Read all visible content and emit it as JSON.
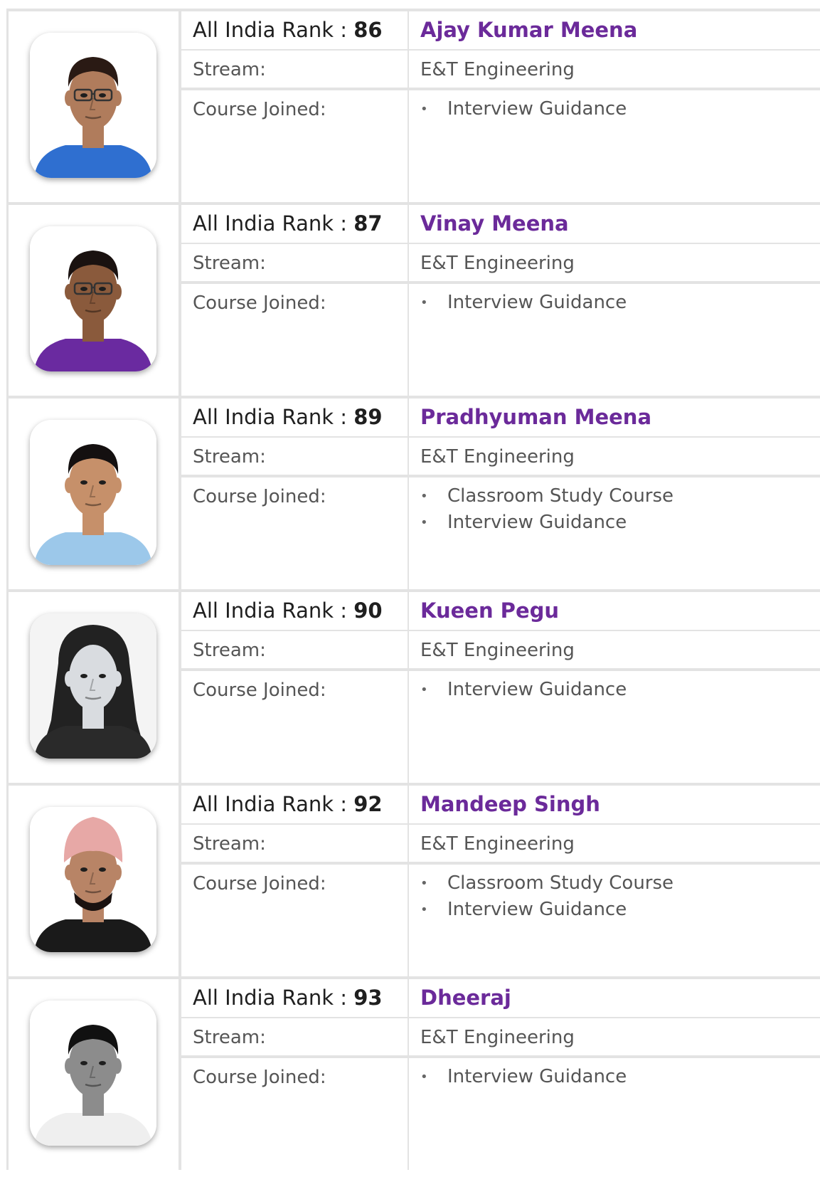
{
  "labels": {
    "rank": "All India Rank",
    "stream": "Stream:",
    "course": "Course Joined:",
    "bullet": "•"
  },
  "students": [
    {
      "rank": "86",
      "name": "Ajay Kumar Meena",
      "stream": "E&T Engineering",
      "courses": [
        "Interview Guidance"
      ],
      "shirt": "#2f6fd0",
      "bg": "#ffffff",
      "skin": "#b07c5c",
      "hair": "#2a1a14",
      "glasses": true,
      "headwear": "none"
    },
    {
      "rank": "87",
      "name": "Vinay Meena",
      "stream": "E&T Engineering",
      "courses": [
        "Interview Guidance"
      ],
      "shirt": "#6a2aa0",
      "bg": "#ffffff",
      "skin": "#8a5a3c",
      "hair": "#1a1210",
      "glasses": true,
      "headwear": "none"
    },
    {
      "rank": "89",
      "name": "Pradhyuman Meena",
      "stream": "E&T Engineering",
      "courses": [
        "Classroom Study Course",
        "Interview Guidance"
      ],
      "shirt": "#9cc8ea",
      "bg": "#ffffff",
      "skin": "#c6906a",
      "hair": "#141010",
      "glasses": false,
      "headwear": "none"
    },
    {
      "rank": "90",
      "name": "Kueen Pegu",
      "stream": "E&T Engineering",
      "courses": [
        "Interview Guidance"
      ],
      "shirt": "#2a2a2a",
      "bg": "#f4f4f4",
      "skin": "#d9dce0",
      "hair": "#222222",
      "glasses": false,
      "headwear": "long-hair"
    },
    {
      "rank": "92",
      "name": "Mandeep Singh",
      "stream": "E&T Engineering",
      "courses": [
        "Classroom Study Course",
        "Interview Guidance"
      ],
      "shirt": "#1a1a1a",
      "bg": "#ffffff",
      "skin": "#b88466",
      "hair": "#1a1210",
      "glasses": false,
      "headwear": "turban"
    },
    {
      "rank": "93",
      "name": "Dheeraj",
      "stream": "E&T Engineering",
      "courses": [
        "Interview Guidance"
      ],
      "shirt": "#efefef",
      "bg": "#ffffff",
      "skin": "#8c8c8c",
      "hair": "#111111",
      "glasses": false,
      "headwear": "none"
    }
  ]
}
